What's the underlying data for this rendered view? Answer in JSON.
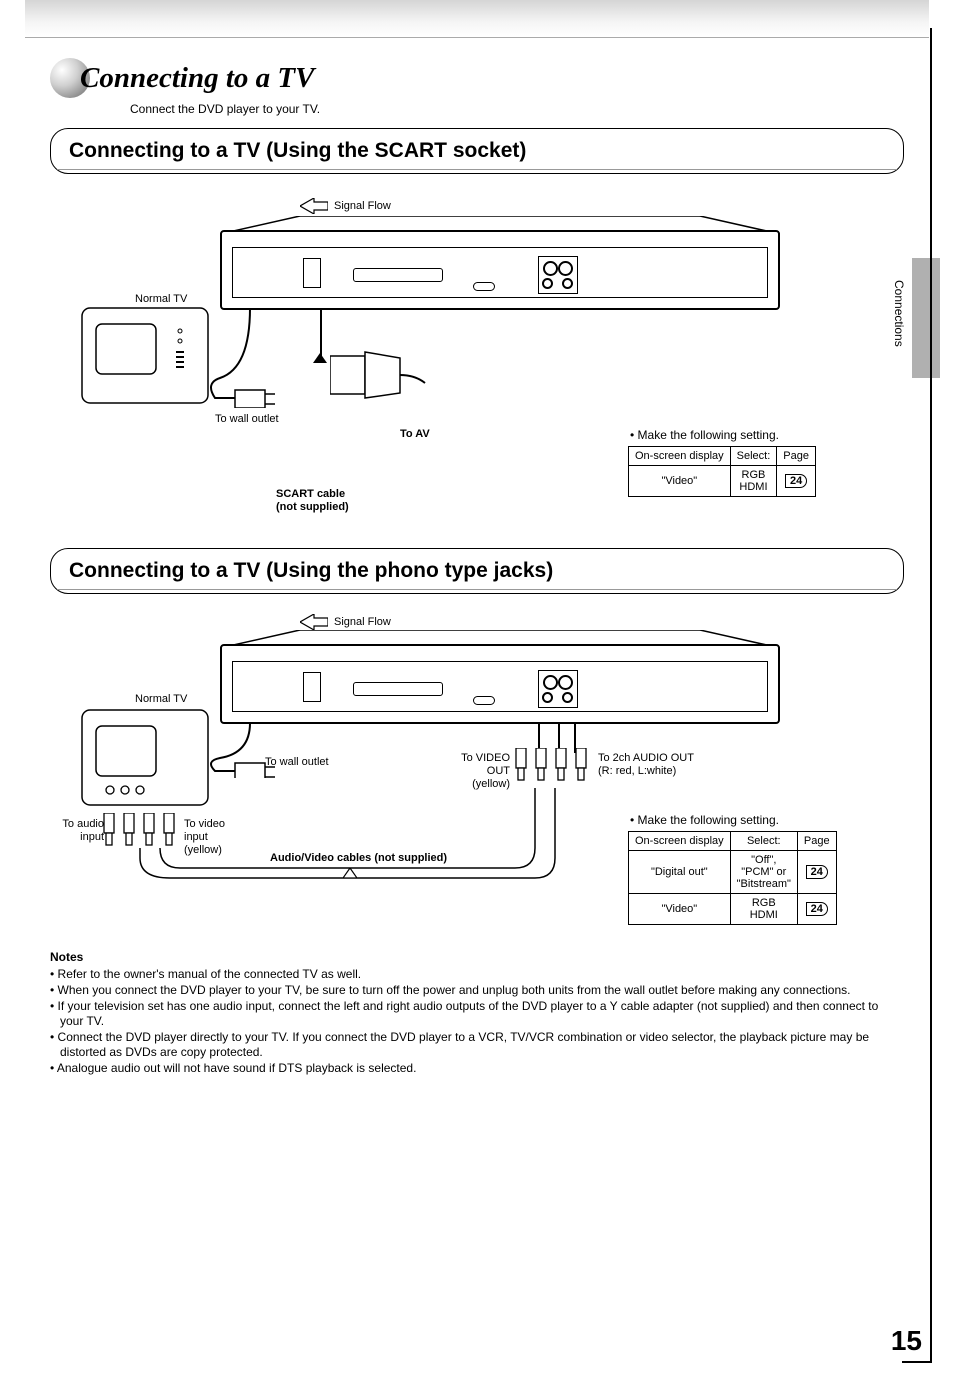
{
  "section_tab": "Connections",
  "chapter": {
    "title": "Connecting to a TV",
    "subtitle": "Connect the DVD player to your TV."
  },
  "section1": {
    "heading": "Connecting to a TV (Using the SCART socket)",
    "signal_flow": "Signal Flow",
    "normal_tv": "Normal TV",
    "to_wall_outlet": "To wall outlet",
    "to_av": "To AV",
    "scart_cable_l1": "SCART cable",
    "scart_cable_l2": "(not supplied)",
    "make_setting": "•  Make the following setting.",
    "table": {
      "h1": "On-screen display",
      "h2": "Select:",
      "h3": "Page",
      "r1c1": "\"Video\"",
      "r1c2a": "RGB",
      "r1c2b": "HDMI",
      "r1c3": "24"
    }
  },
  "section2": {
    "heading": "Connecting to a TV (Using the phono type jacks)",
    "signal_flow": "Signal Flow",
    "normal_tv": "Normal TV",
    "to_wall_outlet": "To wall outlet",
    "to_video_out_l1": "To VIDEO",
    "to_video_out_l2": "OUT",
    "to_video_out_l3": "(yellow)",
    "to_audio_out_l1": "To 2ch AUDIO OUT",
    "to_audio_out_l2": "(R: red, L:white)",
    "to_audio_input_l1": "To audio",
    "to_audio_input_l2": "input",
    "to_video_input_l1": "To video",
    "to_video_input_l2": "input",
    "to_video_input_l3": "(yellow)",
    "av_cables": "Audio/Video cables (not supplied)",
    "make_setting": "•  Make the following setting.",
    "table": {
      "h1": "On-screen display",
      "h2": "Select:",
      "h3": "Page",
      "r1c1": "\"Digital out\"",
      "r1c2a": "\"Off\",",
      "r1c2b": "\"PCM\" or",
      "r1c2c": "\"Bitstream\"",
      "r1c3": "24",
      "r2c1": "\"Video\"",
      "r2c2a": "RGB",
      "r2c2b": "HDMI",
      "r2c3": "24"
    }
  },
  "notes": {
    "heading": "Notes",
    "items": [
      "• Refer to the owner's manual of the connected TV as well.",
      "• When you connect the DVD player to your TV, be sure to turn off the power and unplug both units from the wall outlet before making any connections.",
      "• If your television set has one audio input, connect the left and right audio outputs of the DVD player to a Y cable adapter (not supplied) and then connect to your TV.",
      "• Connect the DVD player directly to your TV.  If you connect the DVD player to a VCR, TV/VCR combination or video selector, the playback picture may be distorted as DVDs are copy protected.",
      "• Analogue audio out will not have sound if DTS playback is selected."
    ]
  },
  "page_number": "15"
}
